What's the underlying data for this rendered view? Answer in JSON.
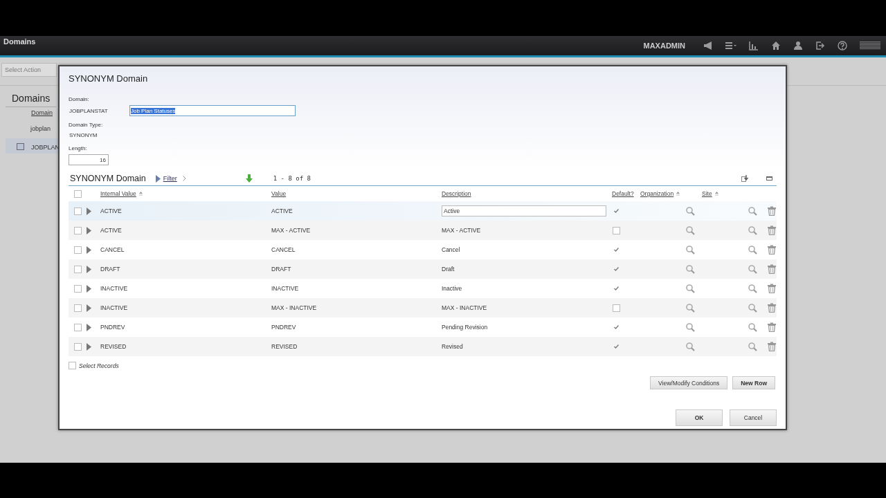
{
  "app_bar": {
    "title": "Domains",
    "user": "MAXADMIN"
  },
  "background_page": {
    "action_field": {
      "placeholder": "Select Action"
    },
    "list_title": "Domains",
    "column_header": "Domain",
    "filter_value": "jobplan",
    "rows": [
      {
        "label": "JOBPLAN",
        "selected": true
      }
    ]
  },
  "dialog": {
    "title": "SYNONYM Domain",
    "fields": {
      "domain_label": "Domain:",
      "domain_value": "JOBPLANSTAT",
      "description_value": "Job Plan Statuses",
      "domain_type_label": "Domain Type:",
      "domain_type_value": "SYNONYM",
      "length_label": "Length:",
      "length_value": "16"
    },
    "table": {
      "title": "SYNONYM Domain",
      "filter_label": "Filter",
      "pagination": "1 - 8 of 8",
      "columns": [
        {
          "label": "Internal Value",
          "sortable": true
        },
        {
          "label": "Value",
          "sortable": false
        },
        {
          "label": "Description",
          "sortable": false
        },
        {
          "label": "Default?",
          "sortable": false
        },
        {
          "label": "Organization",
          "sortable": true
        },
        {
          "label": "Site",
          "sortable": true
        }
      ],
      "rows": [
        {
          "internal_value": "ACTIVE",
          "value": "ACTIVE",
          "description": "Active",
          "default": true,
          "selected": true
        },
        {
          "internal_value": "ACTIVE",
          "value": "MAX - ACTIVE",
          "description": "MAX - ACTIVE",
          "default": false,
          "selected": false
        },
        {
          "internal_value": "CANCEL",
          "value": "CANCEL",
          "description": "Cancel",
          "default": true,
          "selected": false
        },
        {
          "internal_value": "DRAFT",
          "value": "DRAFT",
          "description": "Draft",
          "default": true,
          "selected": false
        },
        {
          "internal_value": "INACTIVE",
          "value": "INACTIVE",
          "description": "Inactive",
          "default": true,
          "selected": false
        },
        {
          "internal_value": "INACTIVE",
          "value": "MAX - INACTIVE",
          "description": "MAX - INACTIVE",
          "default": false,
          "selected": false
        },
        {
          "internal_value": "PNDREV",
          "value": "PNDREV",
          "description": "Pending Revision",
          "default": true,
          "selected": false
        },
        {
          "internal_value": "REVISED",
          "value": "REVISED",
          "description": "Revised",
          "default": true,
          "selected": false
        }
      ],
      "select_all": {
        "checked": false
      },
      "select_records": {
        "label": "Select Records",
        "checked": false
      },
      "buttons": [
        {
          "label": "View/Modify Conditions",
          "primary": false
        },
        {
          "label": "New Row",
          "primary": true
        }
      ]
    },
    "footer_buttons": [
      {
        "label": "OK",
        "primary": true
      },
      {
        "label": "Cancel",
        "primary": false
      }
    ]
  }
}
